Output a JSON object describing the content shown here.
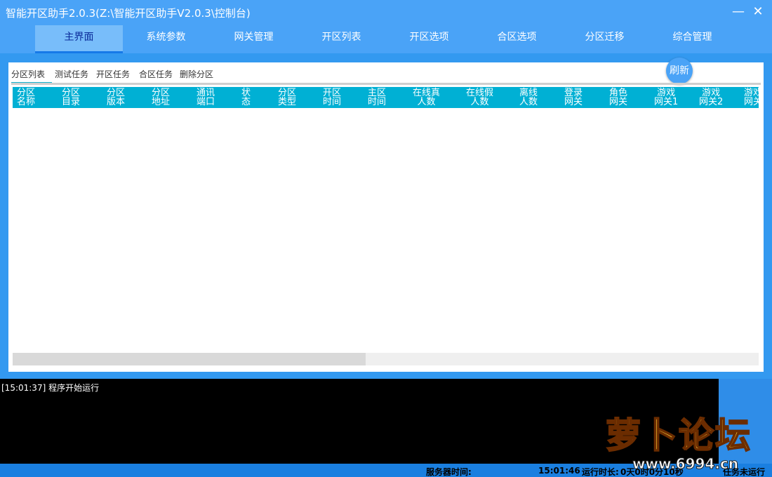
{
  "window": {
    "title": "智能开区助手2.0.3(Z:\\智能开区助手V2.0.3\\控制台)",
    "minimize_icon": "minimize-icon",
    "close_icon": "close-icon"
  },
  "nav": {
    "tabs": [
      {
        "label": "主界面",
        "active": true
      },
      {
        "label": "系统参数",
        "active": false
      },
      {
        "label": "网关管理",
        "active": false
      },
      {
        "label": "开区列表",
        "active": false
      },
      {
        "label": "开区选项",
        "active": false
      },
      {
        "label": "合区选项",
        "active": false
      },
      {
        "label": "分区迁移",
        "active": false
      },
      {
        "label": "综合管理",
        "active": false
      }
    ]
  },
  "main": {
    "refresh_label": "刷新",
    "subtabs": [
      {
        "label": "分区列表",
        "active": true
      },
      {
        "label": "测试任务",
        "active": false
      },
      {
        "label": "开区任务",
        "active": false
      },
      {
        "label": "合区任务",
        "active": false
      },
      {
        "label": "删除分区",
        "active": false
      }
    ],
    "table": {
      "columns": [
        {
          "line1": "分区",
          "line2": "名称"
        },
        {
          "line1": "分区",
          "line2": "目录"
        },
        {
          "line1": "分区",
          "line2": "版本"
        },
        {
          "line1": "分区",
          "line2": "地址"
        },
        {
          "line1": "通讯",
          "line2": "端口"
        },
        {
          "line1": "状",
          "line2": "态"
        },
        {
          "line1": "分区",
          "line2": "类型"
        },
        {
          "line1": "开区",
          "line2": "时间"
        },
        {
          "line1": "主区",
          "line2": "时间"
        },
        {
          "line1": "在线真",
          "line2": "人数"
        },
        {
          "line1": "在线假",
          "line2": "人数"
        },
        {
          "line1": "离线",
          "line2": "人数"
        },
        {
          "line1": "登录",
          "line2": "网关"
        },
        {
          "line1": "角色",
          "line2": "网关"
        },
        {
          "line1": "游戏",
          "line2": "网关1"
        },
        {
          "line1": "游戏",
          "line2": "网关2"
        },
        {
          "line1": "游戏",
          "line2": "网关"
        }
      ]
    }
  },
  "log": {
    "lines": [
      "[15:01:37] 程序开始运行"
    ]
  },
  "status": {
    "server_time_label": "服务器时间:",
    "server_time": "15:01:46",
    "runtime_label": "运行时长:",
    "runtime_value": "0天0时0分10秒",
    "task_label": "任务未运行"
  },
  "watermark": {
    "logo_text": "萝卜论坛",
    "url": "www.6994.cn"
  }
}
